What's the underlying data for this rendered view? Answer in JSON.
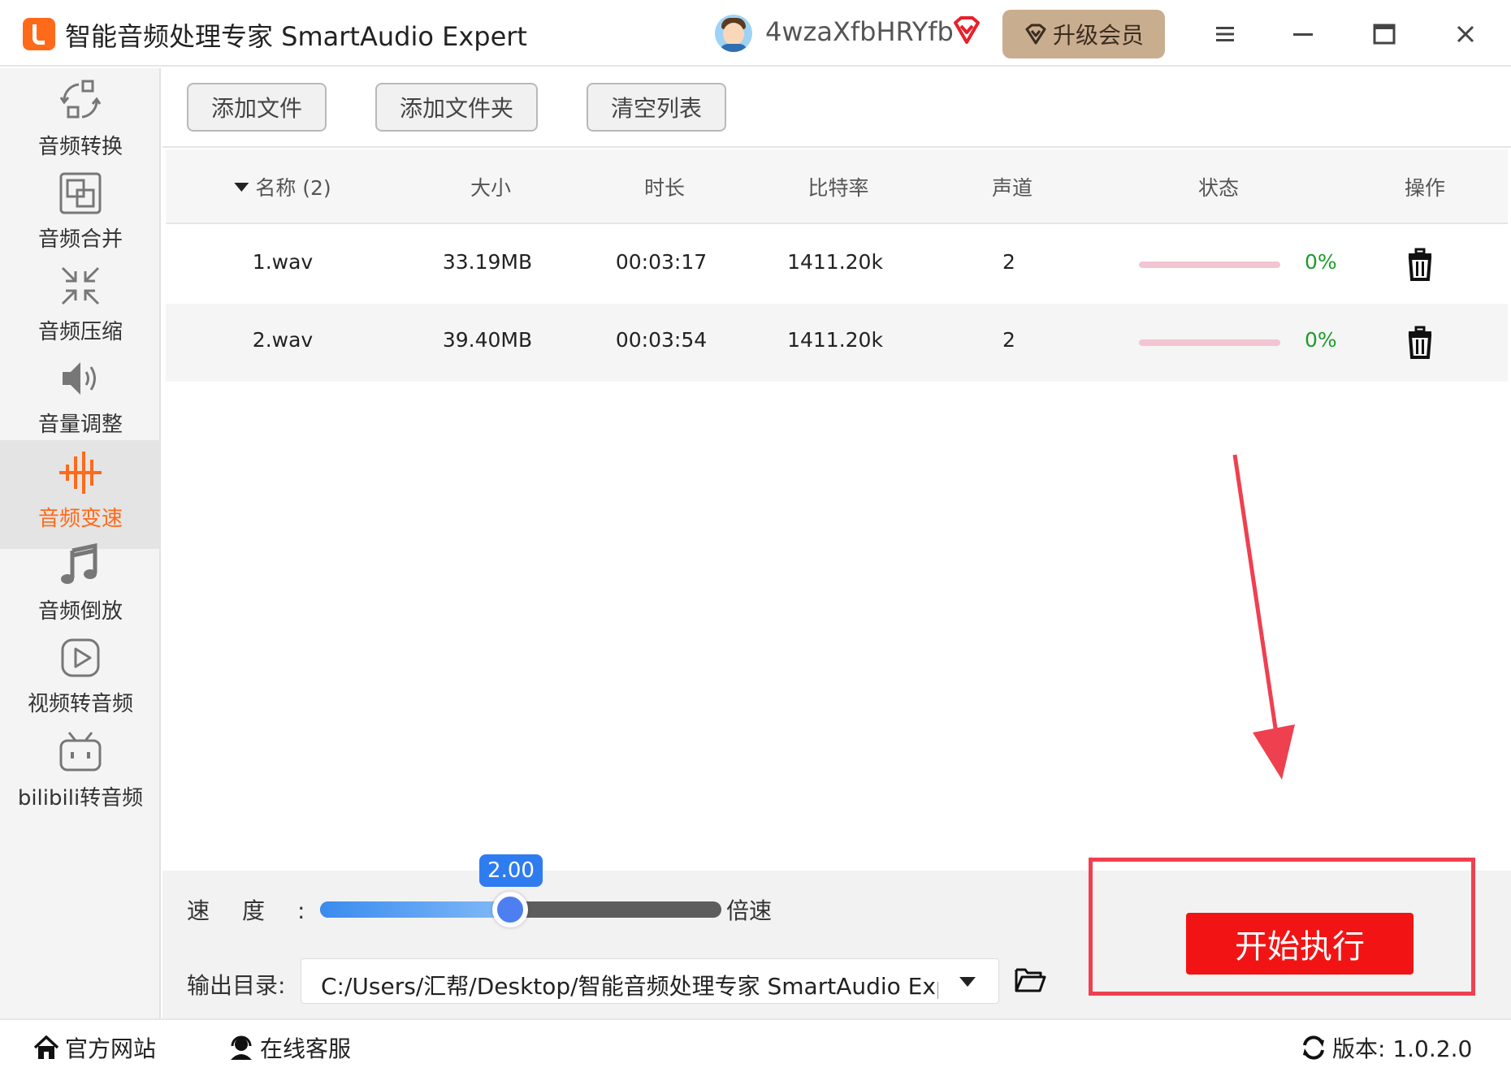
{
  "app": {
    "title": "智能音频处理专家 SmartAudio Expert",
    "username": "4wzaXfbHRYfb",
    "upgrade_label": "升级会员"
  },
  "sidebar": {
    "items": [
      {
        "label": "音频转换",
        "icon": "audio-convert-icon"
      },
      {
        "label": "音频合并",
        "icon": "audio-merge-icon"
      },
      {
        "label": "音频压缩",
        "icon": "audio-compress-icon"
      },
      {
        "label": "音量调整",
        "icon": "volume-icon"
      },
      {
        "label": "音频变速",
        "icon": "audio-speed-icon",
        "active": true
      },
      {
        "label": "音频倒放",
        "icon": "music-note-icon"
      },
      {
        "label": "视频转音频",
        "icon": "video-play-icon"
      },
      {
        "label": "bilibili转音频",
        "icon": "bilibili-tv-icon"
      }
    ]
  },
  "toolbar": {
    "add_file": "添加文件",
    "add_folder": "添加文件夹",
    "clear_list": "清空列表"
  },
  "table": {
    "headers": {
      "name": "名称 (2)",
      "size": "大小",
      "duration": "时长",
      "bitrate": "比特率",
      "channels": "声道",
      "status": "状态",
      "action": "操作"
    },
    "rows": [
      {
        "name": "1.wav",
        "size": "33.19MB",
        "duration": "00:03:17",
        "bitrate": "1411.20k",
        "channels": "2",
        "progress": 0,
        "status_pct": "0%"
      },
      {
        "name": "2.wav",
        "size": "39.40MB",
        "duration": "00:03:54",
        "bitrate": "1411.20k",
        "channels": "2",
        "progress": 0,
        "status_pct": "0%"
      }
    ]
  },
  "speed": {
    "label": "速度:",
    "value": "2.00",
    "position_fraction": 0.45,
    "unit": "倍速"
  },
  "output": {
    "label": "输出目录:",
    "path": "C:/Users/汇帮/Desktop/智能音频处理专家 SmartAudio Exp"
  },
  "start_button": "开始执行",
  "footer": {
    "official_site": "官方网站",
    "online_service": "在线客服",
    "version": "版本: 1.0.2.0"
  },
  "colors": {
    "accent_orange": "#ff6a1a",
    "start_red": "#f21414",
    "highlight_red": "#ef4050",
    "status_green": "#1d9b2a",
    "slider_blue": "#2f7cf0",
    "upgrade_tan": "#c9ad8f"
  }
}
